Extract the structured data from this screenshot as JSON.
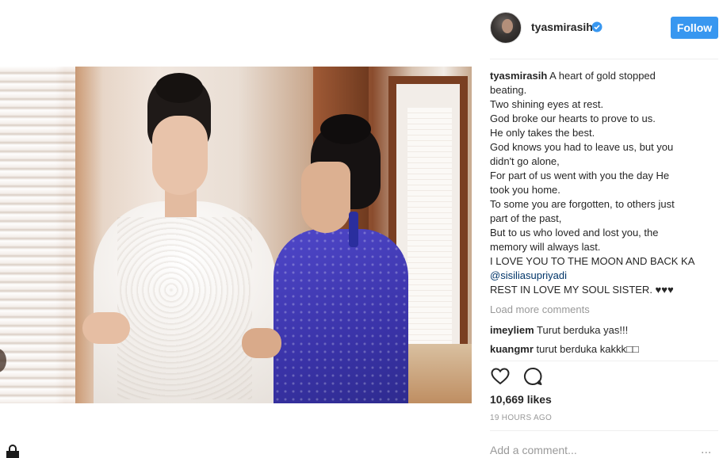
{
  "post": {
    "image_alt": "Two women, one in a white lace dress and one in a blue dress, by a window",
    "author": {
      "username": "tyasmirasih",
      "verified": true
    },
    "follow_label": "Follow",
    "caption": {
      "username": "tyasmirasih",
      "lines": [
        "A heart of gold stopped",
        "beating.",
        "Two shining eyes at rest.",
        "God broke our hearts to prove to us.",
        "He only takes the best.",
        "God knows you had to leave us, but you",
        "didn't go alone,",
        "For part of us went with you the day He",
        "took you home.",
        "To some you are forgotten, to others just",
        "part of the past,",
        "But to us who loved and lost you, the",
        "memory will always last.",
        "I LOVE YOU TO THE MOON AND BACK KA",
        "@sisiliasupriyadi",
        "REST IN LOVE MY SOUL SISTER. ♥♥♥"
      ]
    },
    "load_more_label": "Load more comments",
    "comments": [
      {
        "username": "imeyliem",
        "text": "Turut berduka yas!!!"
      },
      {
        "username": "kuangmr",
        "text": "turut berduka kakkk□□"
      }
    ],
    "likes_label": "10,669 likes",
    "timestamp": "19 HOURS AGO",
    "add_comment_placeholder": "Add a comment...",
    "more_options_label": "..."
  },
  "colors": {
    "follow_button": "#3897f0",
    "verified_badge": "#3897f0",
    "muted_text": "#999999",
    "mention": "#003569"
  },
  "icons": {
    "verified": "verified-badge-icon",
    "like": "heart-icon",
    "comment": "comment-bubble-icon",
    "options": "more-options-icon",
    "bag": "shopping-bag-icon"
  }
}
